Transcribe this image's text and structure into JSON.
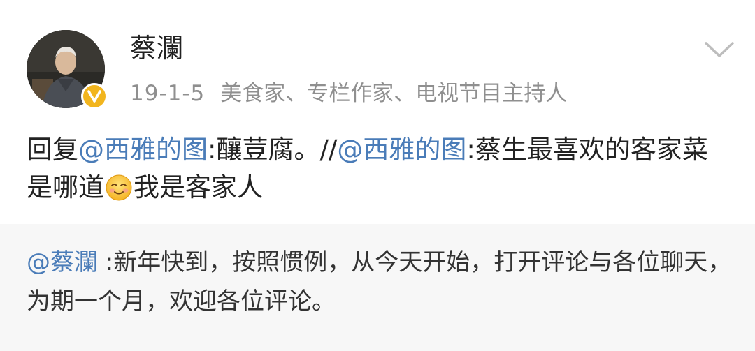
{
  "colors": {
    "mention": "#4a7cb8",
    "meta_text": "#8f8f8f",
    "badge": "#f2b51e",
    "comment_bg": "#f7f7f7"
  },
  "post": {
    "avatar_icon": "user-avatar",
    "verified_icon": "verified-badge",
    "more_icon": "chevron-down",
    "username": "蔡瀾",
    "date": "19-1-5",
    "bio": "美食家、专栏作家、电视节目主持人",
    "body": {
      "reply_prefix": "回复",
      "mention_1": "@西雅的图",
      "text_1": ":釀荳腐。//",
      "mention_2": "@西雅的图",
      "text_2": ":蔡生最喜欢的客家菜是哪道",
      "emoji": "smile-emoji",
      "text_3": "我是客家人"
    }
  },
  "pinned_comment": {
    "mention": "@蔡瀾",
    "text": " :新年快到，按照惯例，从今天开始，打开评论与各位聊天，为期一个月，欢迎各位评论。"
  }
}
